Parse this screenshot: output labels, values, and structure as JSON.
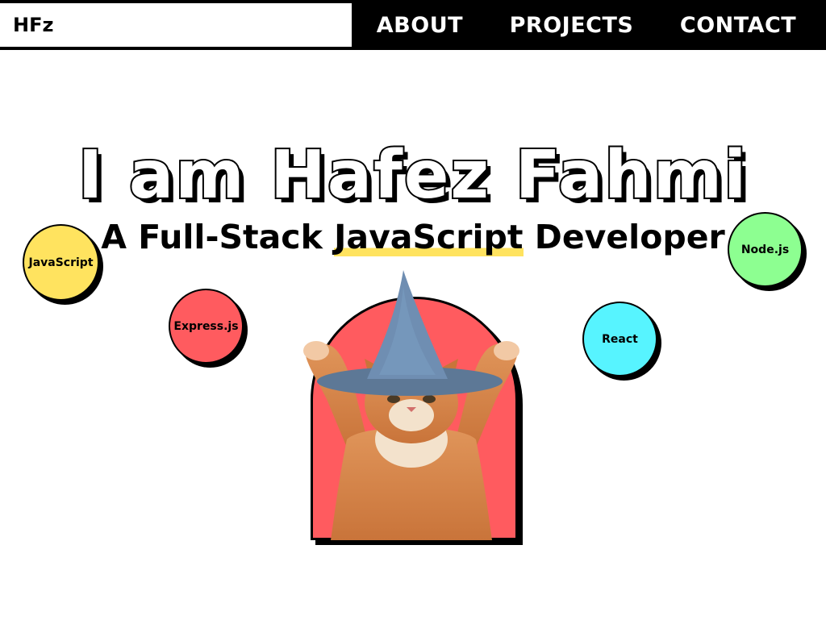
{
  "nav": {
    "brand": "HFz",
    "links": [
      "ABOUT",
      "PROJECTS",
      "CONTACT"
    ]
  },
  "hero": {
    "title": "I am Hafez Fahmi",
    "subtitle_pre": "A Full-Stack ",
    "subtitle_highlight": "JavaScript",
    "subtitle_post": " Developer"
  },
  "tech_bubbles": {
    "javascript": {
      "label": "JavaScript",
      "color": "#ffe35f"
    },
    "expressjs": {
      "label": "Express.js",
      "color": "#ff5b5f"
    },
    "react": {
      "label": "React",
      "color": "#57f4ff"
    },
    "nodejs": {
      "label": "Node.js",
      "color": "#8dff91"
    }
  },
  "colors": {
    "accent_yellow": "#ffe35f",
    "portrait_bg": "#ff5b5f",
    "nav_bg": "#000000"
  },
  "image": {
    "icon": "wizard-cat-image"
  }
}
